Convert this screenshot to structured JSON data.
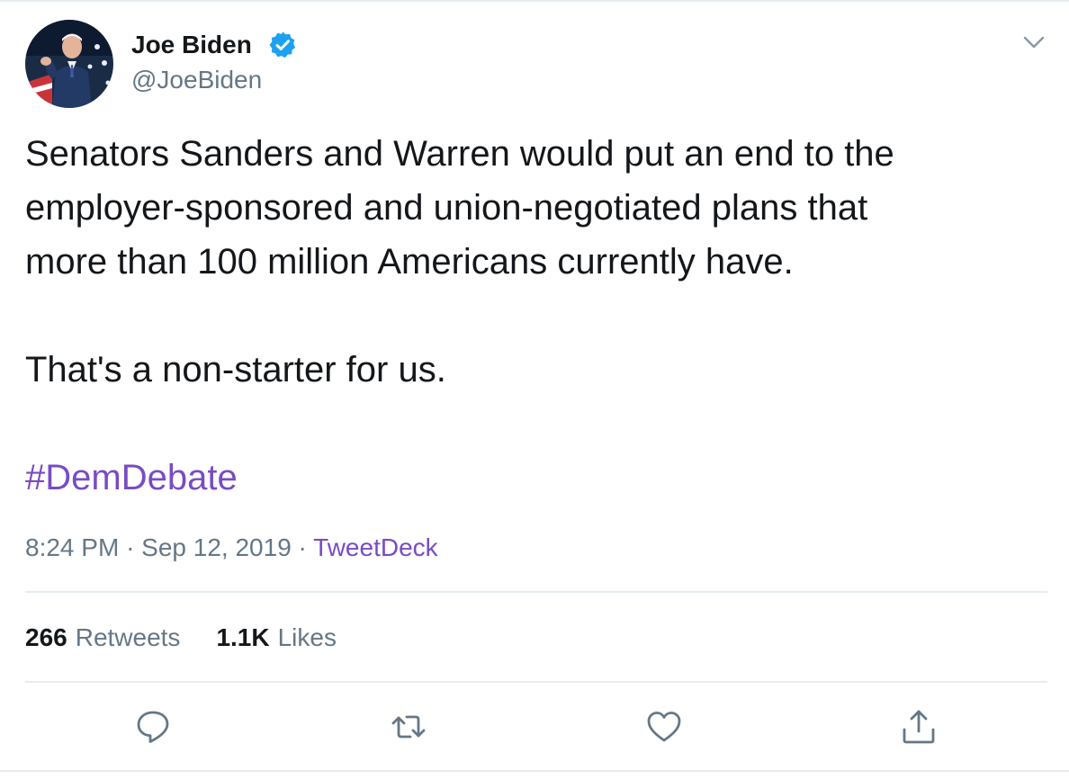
{
  "tweet": {
    "author": {
      "name": "Joe Biden",
      "handle": "@JoeBiden",
      "verified": true
    },
    "text_lines": [
      "Senators Sanders and Warren would put an end to the",
      "employer-sponsored and union-negotiated plans that",
      "more than 100 million Americans currently have.",
      "That's a non-starter for us."
    ],
    "hashtag": "#DemDebate",
    "time": "8:24 PM",
    "separator": "·",
    "date": "Sep 12, 2019",
    "source": "TweetDeck",
    "stats": {
      "retweets_count": "266",
      "retweets_label": "Retweets",
      "likes_count": "1.1K",
      "likes_label": "Likes"
    },
    "actions": [
      "reply-icon",
      "retweet-icon",
      "like-icon",
      "share-icon"
    ]
  },
  "colors": {
    "text": "#14171a",
    "secondary": "#657786",
    "link": "#794bc4",
    "verified": "#1da1f2",
    "divider": "#e6ecf0"
  }
}
